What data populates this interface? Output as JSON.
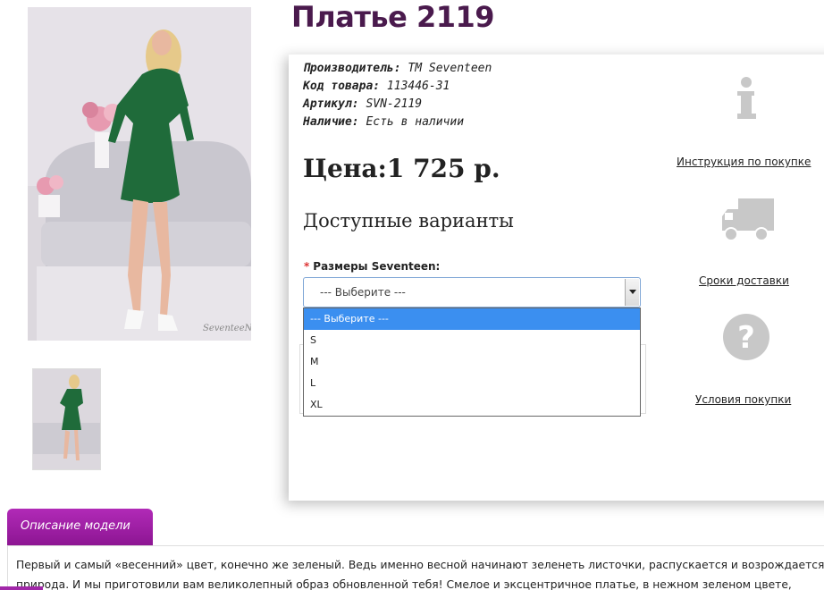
{
  "product": {
    "title": "Платье 2119",
    "meta": [
      {
        "key": "Производитель:",
        "value": "ТМ Seventeen"
      },
      {
        "key": "Код товара:",
        "value": "113446-31"
      },
      {
        "key": "Артикул:",
        "value": "SVN-2119"
      },
      {
        "key": "Наличие:",
        "value": "Есть в наличии"
      }
    ],
    "price": "Цена:1 725 р.",
    "variants_heading": "Доступные варианты",
    "photo_watermark": "SeventeeN"
  },
  "size_select": {
    "required_mark": "*",
    "label": "Размеры Seventeen:",
    "value": "--- Выберите ---",
    "options": [
      "--- Выберите ---",
      "S",
      "M",
      "L",
      "XL"
    ],
    "selected_index": 0
  },
  "side_links": {
    "instructions": "Инструкция по покупке",
    "delivery": "Сроки доставки",
    "terms": "Условия покупки"
  },
  "description": {
    "tab_label": "Описание модели",
    "text_line1": "Первый и самый «весенний» цвет, конечно же зеленый. Ведь именно весной начинают зеленеть листочки, распускается и возрождается",
    "text_line2": "природа. И мы приготовили вам великолепный образ обновленной тебя! Смелое и эксцентричное платье, в нежном зеленом цвете,"
  },
  "colors": {
    "title": "#4a1a4d",
    "tab": "#a128a8",
    "dropdown_highlight": "#3b8ff0",
    "dress_green": "#1f6b3a"
  }
}
